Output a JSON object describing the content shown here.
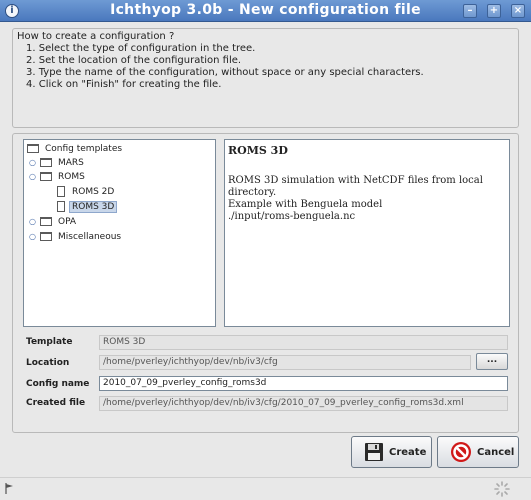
{
  "window": {
    "title": "Ichthyop 3.0b - New configuration file",
    "controls": [
      "minimize",
      "maximize",
      "close"
    ]
  },
  "instructions": {
    "heading": "How to create a configuration ?",
    "steps": [
      "1. Select the type of configuration in the tree.",
      "2. Set the location of the configuration file.",
      "3. Type the name of the configuration, without space or any special characters.",
      "4. Click on \"Finish\" for creating the file."
    ]
  },
  "tree": {
    "root": "Config templates",
    "items": [
      {
        "label": "MARS",
        "type": "folder",
        "expanded": false
      },
      {
        "label": "ROMS",
        "type": "folder",
        "expanded": true
      },
      {
        "label": "ROMS 2D",
        "type": "file"
      },
      {
        "label": "ROMS 3D",
        "type": "file",
        "selected": true
      },
      {
        "label": "OPA",
        "type": "folder",
        "expanded": false
      },
      {
        "label": "Miscellaneous",
        "type": "folder",
        "expanded": false
      }
    ]
  },
  "description": {
    "title": "ROMS 3D",
    "lines": [
      "ROMS 3D simulation with NetCDF files from local",
      "directory.",
      "Example with Benguela model",
      "./input/roms-benguela.nc"
    ]
  },
  "form": {
    "template_label": "Template",
    "template_value": "ROMS 3D",
    "location_label": "Location",
    "location_value": "/home/pverley/ichthyop/dev/nb/iv3/cfg",
    "browse_label": "...",
    "config_name_label": "Config name",
    "config_name_value": "2010_07_09_pverley_config_roms3d",
    "created_file_label": "Created file",
    "created_file_value": "/home/pverley/ichthyop/dev/nb/iv3/cfg/2010_07_09_pverley_config_roms3d.xml"
  },
  "buttons": {
    "create_label": "Create",
    "cancel_label": "Cancel"
  },
  "colors": {
    "titlebar": "#5a86c6",
    "selection": "#c9d7ea",
    "cancel_icon": "#d01818"
  },
  "icons": {
    "create": "floppy-disk-icon",
    "cancel": "no-entry-icon",
    "status_left": "flag-icon",
    "status_right": "busy-spinner-icon"
  }
}
